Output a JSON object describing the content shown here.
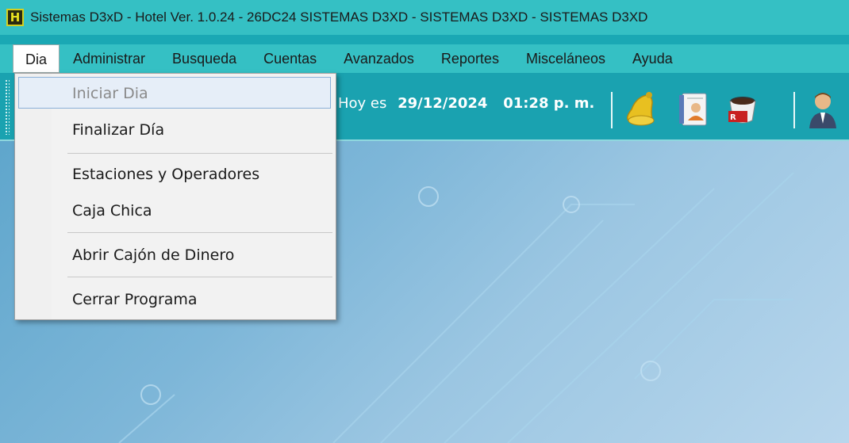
{
  "window": {
    "title": "Sistemas D3xD - Hotel  Ver.  1.0.24 - 26DC24  SISTEMAS D3XD - SISTEMAS D3XD - SISTEMAS D3XD",
    "app_icon_letter": "H"
  },
  "menubar": {
    "items": [
      {
        "label": "Dia",
        "active": true
      },
      {
        "label": "Administrar"
      },
      {
        "label": "Busqueda"
      },
      {
        "label": "Cuentas"
      },
      {
        "label": "Avanzados"
      },
      {
        "label": "Reportes"
      },
      {
        "label": "Misceláneos"
      },
      {
        "label": "Ayuda"
      }
    ]
  },
  "toolbar": {
    "date_prefix": "Hoy es",
    "date_value": "29/12/2024",
    "time_value": "01:28 p. m.",
    "icons": [
      "bell-icon",
      "contacts-notebook-icon",
      "coffee-cup-icon",
      "user-avatar-icon"
    ]
  },
  "dropdown": {
    "items": [
      {
        "label": "Iniciar Dia",
        "disabled": true
      },
      {
        "label": "Finalizar Día"
      },
      {
        "label": "Estaciones y Operadores"
      },
      {
        "label": "Caja Chica"
      },
      {
        "label": "Abrir Cajón de Dinero"
      },
      {
        "label": "Cerrar Programa"
      }
    ]
  },
  "colors": {
    "titlebar": "#35c0c4",
    "toolbar": "#1aa2b0",
    "workspace": "#7db6d8"
  }
}
